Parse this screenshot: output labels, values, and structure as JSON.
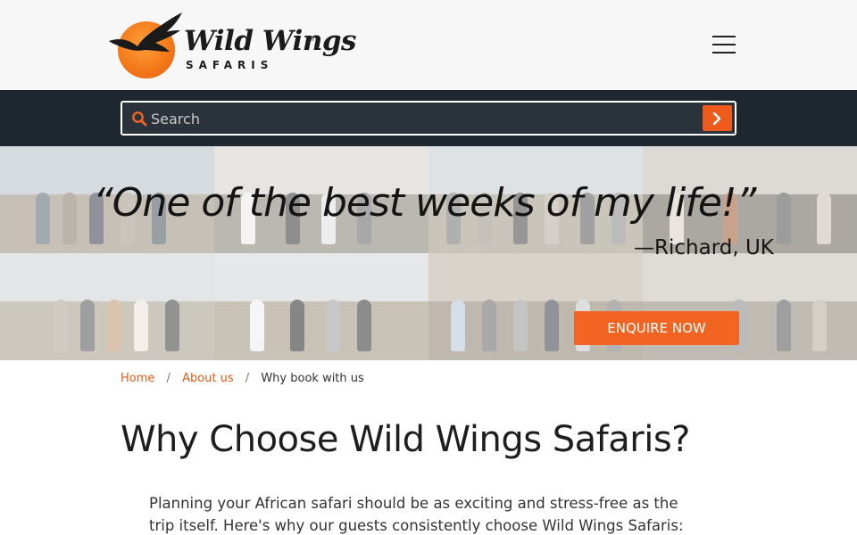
{
  "header": {
    "logo_name": "Wild Wings",
    "logo_sub": "SAFARIS",
    "logo_reg": "®",
    "menu_icon": "hamburger-menu-icon"
  },
  "search": {
    "placeholder": "Search",
    "value": "",
    "search_icon": "search-icon",
    "submit_icon": "chevron-right-icon"
  },
  "hero": {
    "quote": "“One of the best weeks of my life!”",
    "attribution": "—Richard, UK",
    "cta_label": "ENQUIRE NOW"
  },
  "breadcrumb": {
    "home": "Home",
    "separator": "/",
    "about": "About us",
    "current": "Why book with us"
  },
  "main": {
    "title": "Why Choose Wild Wings Safaris?",
    "intro": "Planning your African safari should be as exciting and stress-free as the trip itself. Here's why our guests consistently choose Wild Wings Safaris:"
  },
  "colors": {
    "accent": "#f26422",
    "link": "#e05a14",
    "search_bar_bg": "#1f2830",
    "header_bg": "#f7f7f7"
  }
}
